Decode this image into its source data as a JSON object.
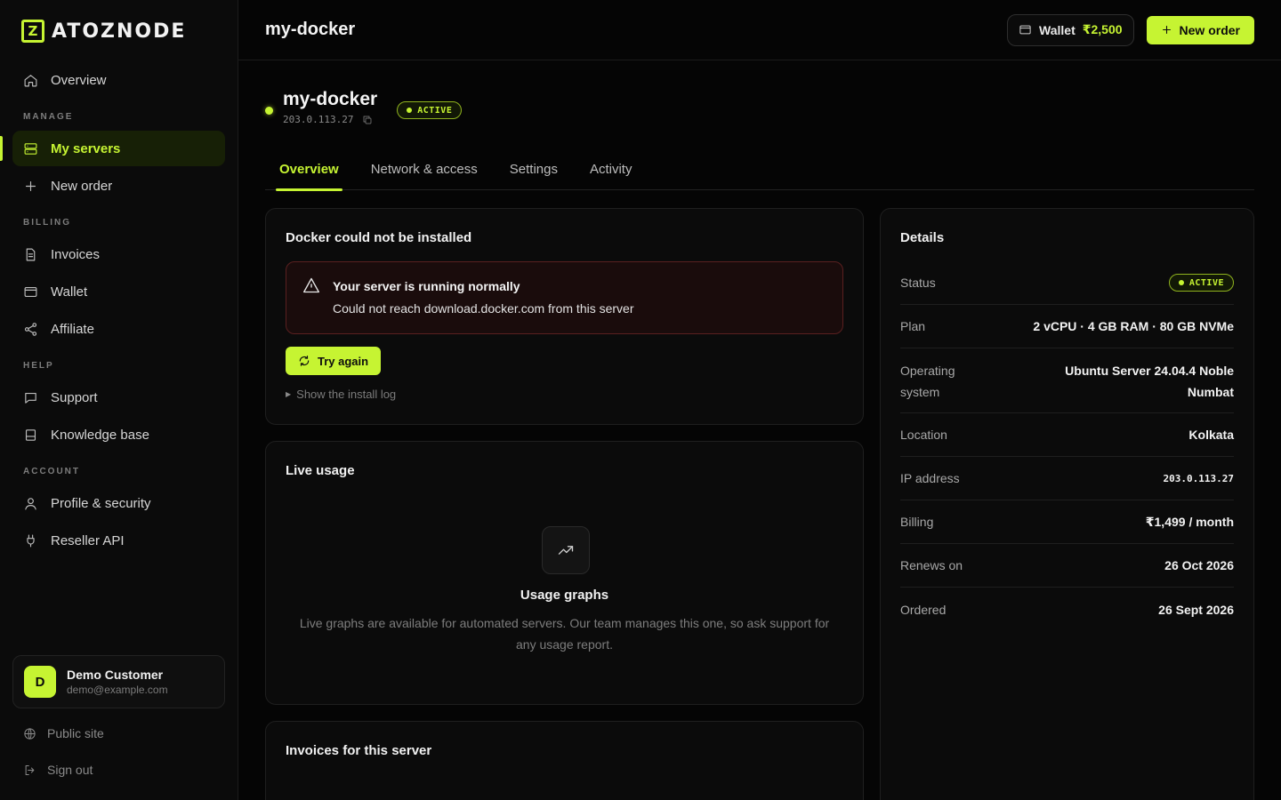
{
  "brand": {
    "mark": "Z",
    "name": "ATOZNODE"
  },
  "sidebar": {
    "overview": "Overview",
    "sections": {
      "manage": "MANAGE",
      "billing": "BILLING",
      "help": "HELP",
      "account": "ACCOUNT"
    },
    "items": {
      "my_servers": "My servers",
      "new_order": "New order",
      "invoices": "Invoices",
      "wallet": "Wallet",
      "affiliate": "Affiliate",
      "support": "Support",
      "knowledge_base": "Knowledge base",
      "profile": "Profile & security",
      "reseller_api": "Reseller API"
    },
    "user": {
      "initial": "D",
      "name": "Demo Customer",
      "email": "demo@example.com"
    },
    "public_site": "Public site",
    "sign_out": "Sign out"
  },
  "topbar": {
    "title": "my-docker",
    "wallet_label": "Wallet",
    "wallet_amount": "₹2,500",
    "new_order": "New order"
  },
  "server": {
    "name": "my-docker",
    "ip": "203.0.113.27",
    "status": "ACTIVE"
  },
  "tabs": [
    "Overview",
    "Network & access",
    "Settings",
    "Activity"
  ],
  "docker": {
    "title": "Docker could not be installed",
    "alert_title": "Your server is running normally",
    "alert_text": "Could not reach download.docker.com from this server",
    "retry": "Try again",
    "log_toggle": "Show the install log"
  },
  "usage": {
    "title": "Live usage",
    "heading": "Usage graphs",
    "text": "Live graphs are available for automated servers. Our team manages this one, so ask support for any usage report."
  },
  "invoices": {
    "title": "Invoices for this server"
  },
  "details": {
    "title": "Details",
    "status_label": "Status",
    "status_value": "ACTIVE",
    "plan_label": "Plan",
    "plan_value": "2 vCPU · 4 GB RAM · 80 GB NVMe",
    "os_label_1": "Operating",
    "os_label_2": "system",
    "os_value_1": "Ubuntu Server 24.04.4 Noble",
    "os_value_2": "Numbat",
    "location_label": "Location",
    "location_value": "Kolkata",
    "ip_label": "IP address",
    "ip_value": "203.0.113.27",
    "billing_label": "Billing",
    "billing_value": "₹1,499 / month",
    "renews_label": "Renews on",
    "renews_value": "26 Oct 2026",
    "ordered_label": "Ordered",
    "ordered_value": "26 Sept 2026"
  },
  "colors": {
    "accent": "#c6f432",
    "background": "#050505",
    "danger_border": "#5a2020"
  }
}
